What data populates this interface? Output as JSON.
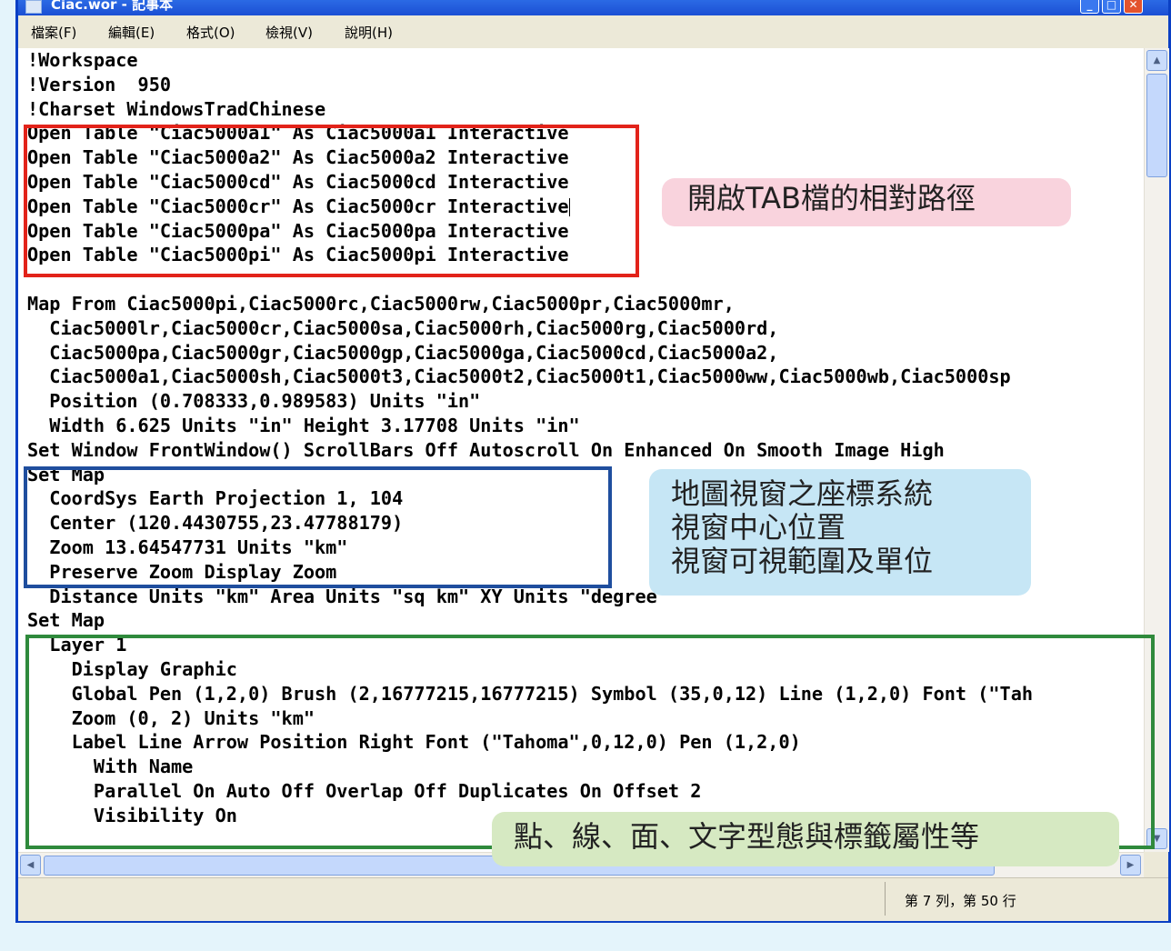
{
  "window": {
    "title": "Ciac.wor - 記事本"
  },
  "menu": [
    "檔案(F)",
    "編輯(E)",
    "格式(O)",
    "檢視(V)",
    "說明(H)"
  ],
  "code_lines": [
    "!Workspace",
    "!Version  950",
    "!Charset WindowsTradChinese",
    "Open Table \"Ciac5000a1\" As Ciac5000a1 Interactive",
    "Open Table \"Ciac5000a2\" As Ciac5000a2 Interactive",
    "Open Table \"Ciac5000cd\" As Ciac5000cd Interactive",
    "Open Table \"Ciac5000cr\" As Ciac5000cr Interactive",
    "Open Table \"Ciac5000pa\" As Ciac5000pa Interactive",
    "Open Table \"Ciac5000pi\" As Ciac5000pi Interactive",
    "",
    "Map From Ciac5000pi,Ciac5000rc,Ciac5000rw,Ciac5000pr,Ciac5000mr,",
    "  Ciac5000lr,Ciac5000cr,Ciac5000sa,Ciac5000rh,Ciac5000rg,Ciac5000rd,",
    "  Ciac5000pa,Ciac5000gr,Ciac5000gp,Ciac5000ga,Ciac5000cd,Ciac5000a2,",
    "  Ciac5000a1,Ciac5000sh,Ciac5000t3,Ciac5000t2,Ciac5000t1,Ciac5000ww,Ciac5000wb,Ciac5000sp",
    "  Position (0.708333,0.989583) Units \"in\"",
    "  Width 6.625 Units \"in\" Height 3.17708 Units \"in\"",
    "Set Window FrontWindow() ScrollBars Off Autoscroll On Enhanced On Smooth Image High",
    "Set Map",
    "  CoordSys Earth Projection 1, 104",
    "  Center (120.4430755,23.47788179)",
    "  Zoom 13.64547731 Units \"km\"",
    "  Preserve Zoom Display Zoom",
    "  Distance Units \"km\" Area Units \"sq km\" XY Units \"degree\"",
    "Set Map",
    "  Layer 1",
    "    Display Graphic",
    "    Global Pen (1,2,0) Brush (2,16777215,16777215) Symbol (35,0,12) Line (1,2,0) Font (\"Tah",
    "    Zoom (0, 2) Units \"km\"",
    "    Label Line Arrow Position Right Font (\"Tahoma\",0,12,0) Pen (1,2,0)",
    "      With Name",
    "      Parallel On Auto Off Overlap Off Duplicates On Offset 2",
    "      Visibility On"
  ],
  "callouts": {
    "tab_path": "開啟TAB檔的相對路徑",
    "map_window": "地圖視窗之座標系統\n視窗中心位置\n視窗可視範圍及單位",
    "layer_style": "點、線、面、文字型態與標籤屬性等"
  },
  "status": {
    "position": "第 7 列，第 50 行"
  },
  "colors": {
    "red_box": "#e2231a",
    "blue_box": "#1f4e9e",
    "green_box": "#2f8a3c",
    "pink_callout": "#f9d3dd",
    "blue_callout": "#c6e6f5",
    "green_callout": "#d6e9c2"
  }
}
